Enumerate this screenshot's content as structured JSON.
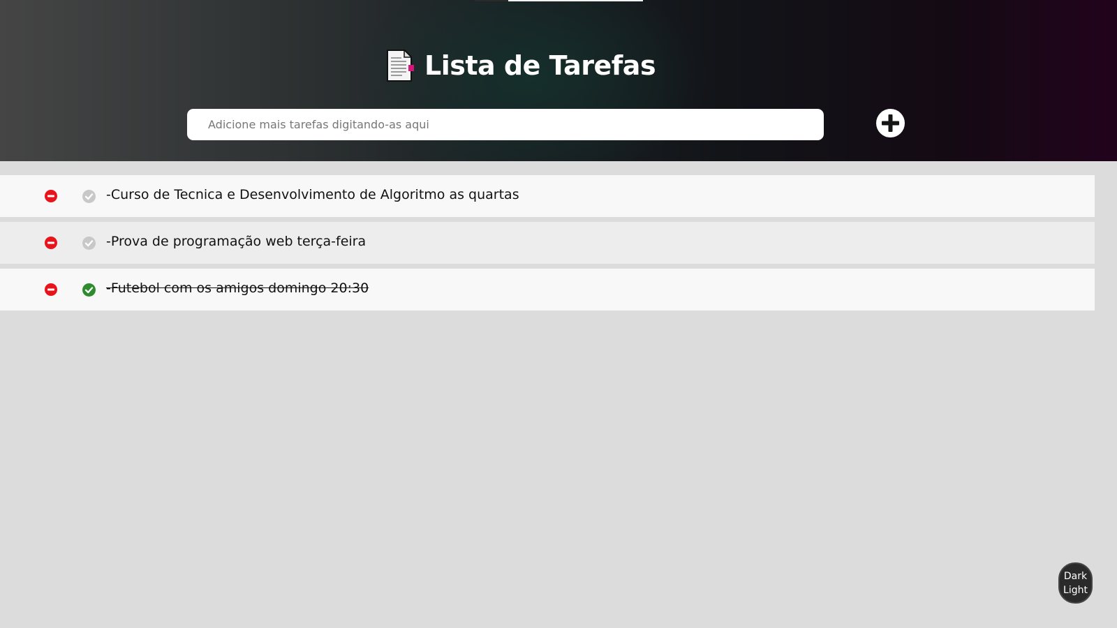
{
  "header": {
    "title": "Lista de Tarefas",
    "icon": "document-icon"
  },
  "input": {
    "placeholder": "Adicione mais tarefas digitando-as aqui",
    "value": ""
  },
  "add_button": {
    "icon": "plus-circle-icon"
  },
  "tasks": [
    {
      "text": "-Curso de Tecnica e Desenvolvimento de Algoritmo as quartas",
      "done": false
    },
    {
      "text": "-Prova de programação web terça-feira",
      "done": false
    },
    {
      "text": "-Futebol com os amigos domingo 20:30",
      "done": true
    }
  ],
  "theme_toggle": {
    "line1": "Dark",
    "line2": "Light"
  },
  "colors": {
    "remove": "#e8141b",
    "check_done": "#2e8b2e",
    "check_pending": "#c8c8c8",
    "accent_icon": "#d8157a"
  }
}
